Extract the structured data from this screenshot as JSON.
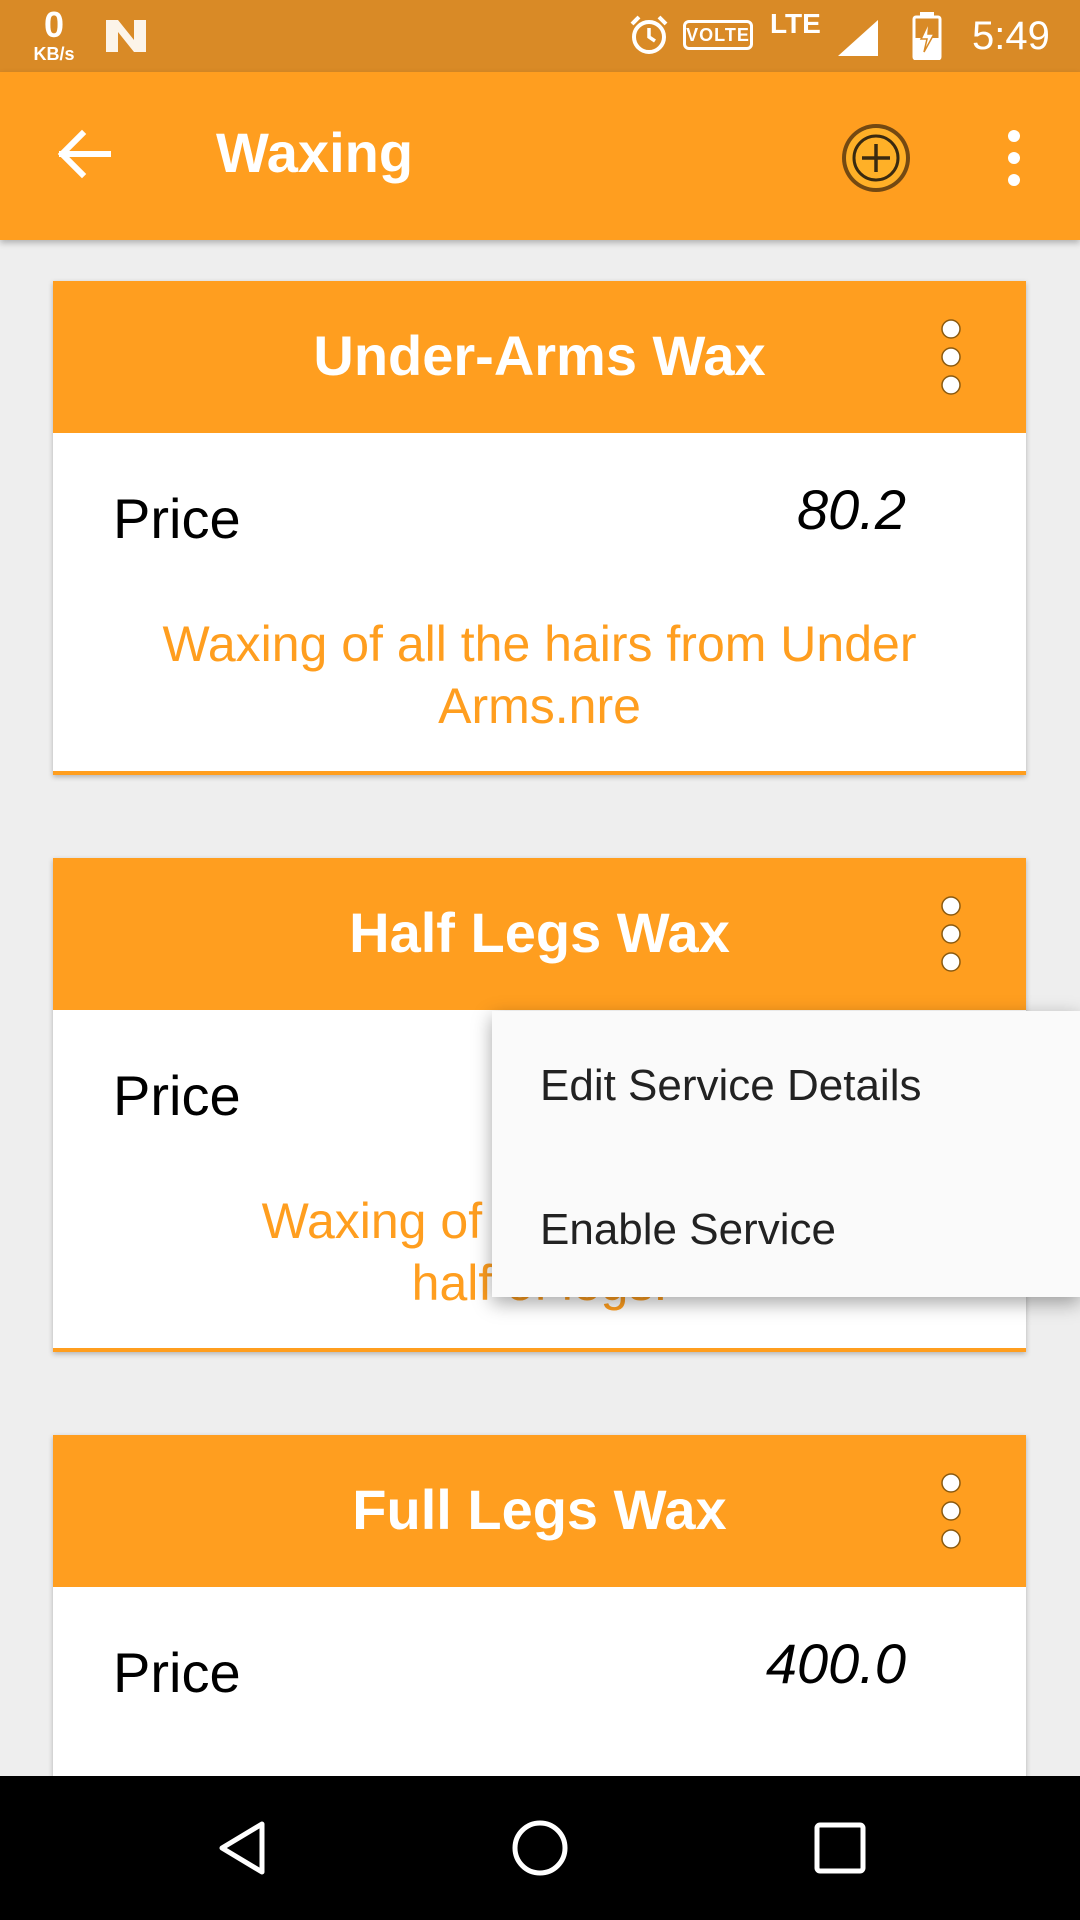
{
  "status_bar": {
    "net_speed_value": "0",
    "net_speed_unit": "KB/s",
    "volte": "VOLTE",
    "network": "LTE",
    "time": "5:49",
    "icons": [
      "n-logo-icon",
      "alarm-icon",
      "signal-icon",
      "battery-charging-icon"
    ]
  },
  "app_bar": {
    "title": "Waxing",
    "icons": [
      "back-arrow-icon",
      "add-circle-icon",
      "more-vert-icon"
    ]
  },
  "cards": [
    {
      "title": "Under-Arms Wax",
      "price_label": "Price",
      "price_value": "80.2",
      "description": "Waxing of all the hairs from Under Arms.nre"
    },
    {
      "title": "Half Legs Wax",
      "price_label": "Price",
      "price_value": "",
      "description_line1_visible": "Waxing of all",
      "description_line2_visible": "half of legs."
    },
    {
      "title": "Full Legs Wax",
      "price_label": "Price",
      "price_value": "400.0"
    }
  ],
  "popup_menu": {
    "items": [
      "Edit Service Details",
      "Enable Service"
    ]
  },
  "colors": {
    "status_bar": "#d98a26",
    "accent": "#ff9e1f",
    "background": "#eeeeee",
    "nav_bar": "#000000"
  },
  "nav_bar": {
    "icons": [
      "nav-back-icon",
      "nav-home-icon",
      "nav-recents-icon"
    ]
  }
}
